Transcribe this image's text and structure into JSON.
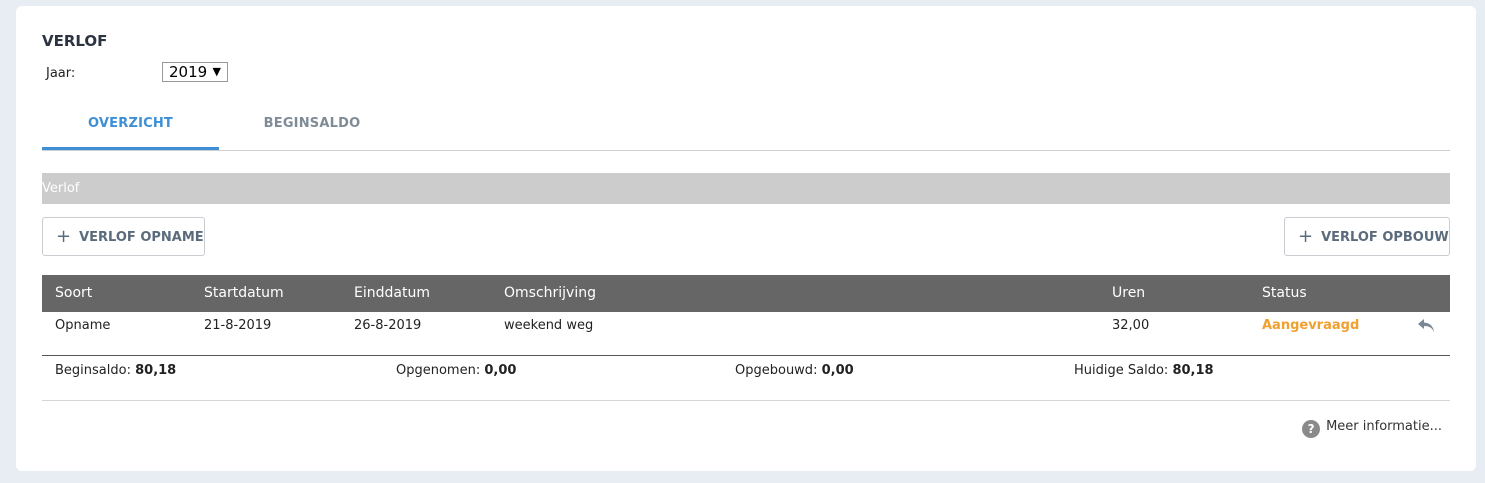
{
  "page": {
    "title": "VERLOF"
  },
  "year": {
    "label": "Jaar:",
    "selected": "2019"
  },
  "tabs": [
    {
      "label": "OVERZICHT",
      "active": true
    },
    {
      "label": "BEGINSALDO",
      "active": false
    }
  ],
  "section": {
    "title": "Verlof"
  },
  "buttons": {
    "opname": "VERLOF OPNAME",
    "opbouw": "VERLOF OPBOUW"
  },
  "table": {
    "headers": [
      "Soort",
      "Startdatum",
      "Einddatum",
      "Omschrijving",
      "Uren",
      "Status"
    ],
    "rows": [
      {
        "soort": "Opname",
        "startdatum": "21-8-2019",
        "einddatum": "26-8-2019",
        "omschrijving": "weekend weg",
        "uren": "32,00",
        "status": "Aangevraagd"
      }
    ]
  },
  "summary": {
    "beginsaldo_label": "Beginsaldo:",
    "beginsaldo_value": "80,18",
    "opgenomen_label": "Opgenomen:",
    "opgenomen_value": "0,00",
    "opgebouwd_label": "Opgebouwd:",
    "opgebouwd_value": "0,00",
    "huidige_label": "Huidige Saldo:",
    "huidige_value": "80,18"
  },
  "info": {
    "label": "Meer informatie...",
    "icon": "question-icon"
  },
  "colors": {
    "accent": "#3d8fd6",
    "status_pending": "#f0a030",
    "table_header": "#666666"
  }
}
